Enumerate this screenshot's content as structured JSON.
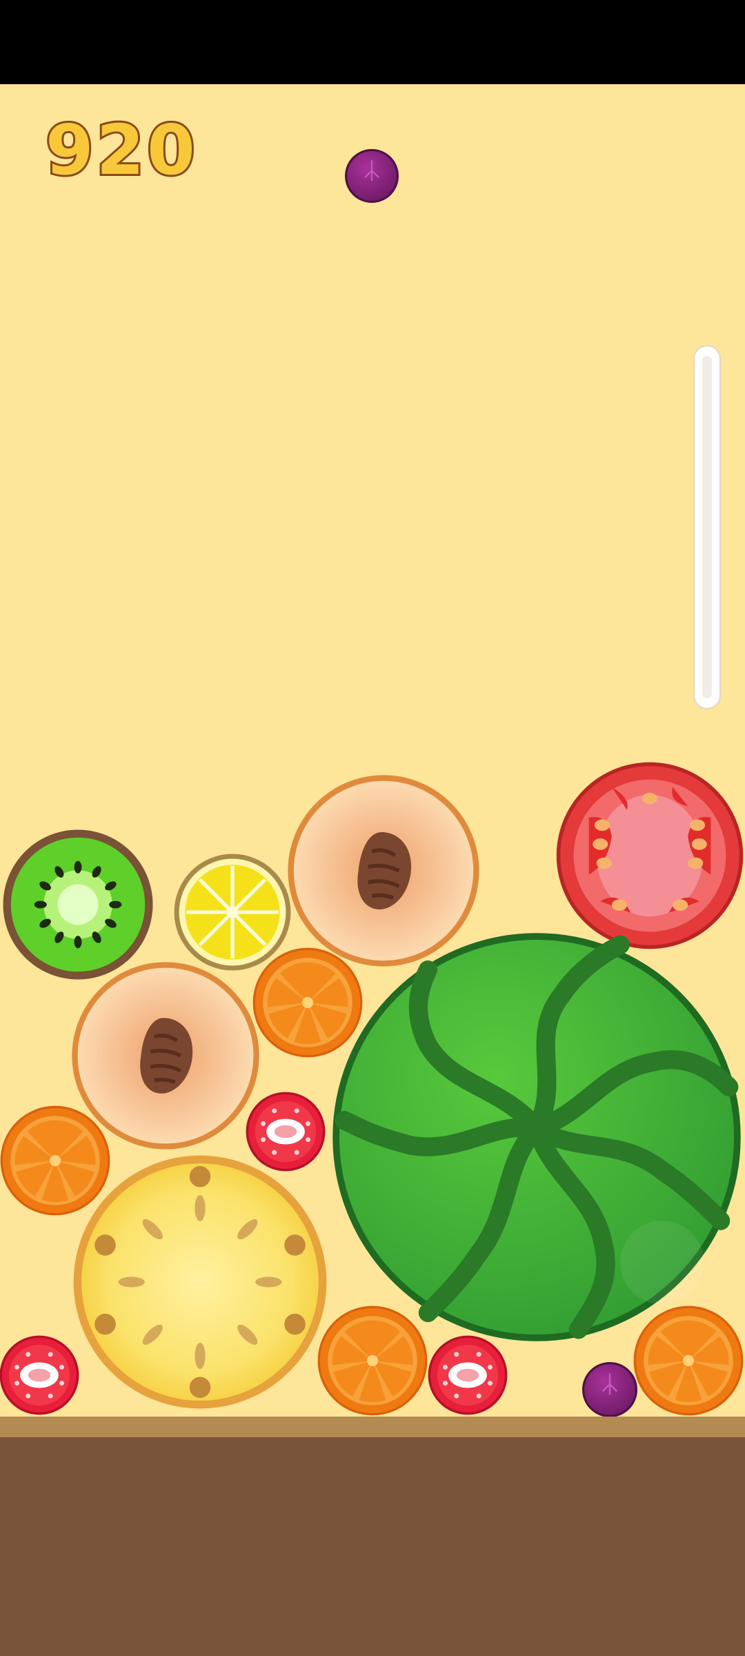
{
  "score": "920",
  "next_fruit": "grape",
  "fruits": [
    {
      "kind": "kiwi"
    },
    {
      "kind": "lemon"
    },
    {
      "kind": "peach"
    },
    {
      "kind": "tomato"
    },
    {
      "kind": "orange"
    },
    {
      "kind": "peach"
    },
    {
      "kind": "watermelon"
    },
    {
      "kind": "strawberry"
    },
    {
      "kind": "orange"
    },
    {
      "kind": "pineapple"
    },
    {
      "kind": "strawberry"
    },
    {
      "kind": "orange"
    },
    {
      "kind": "strawberry"
    },
    {
      "kind": "grape"
    },
    {
      "kind": "orange"
    }
  ],
  "colors": {
    "background": "#fde59a",
    "ground": "#7a543a",
    "ground_rim": "#b48a53",
    "score_fill": "#f7c83a",
    "score_stroke": "#8a4a18"
  }
}
